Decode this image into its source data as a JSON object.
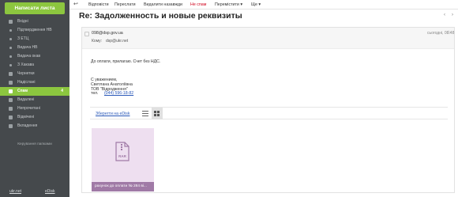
{
  "sidebar": {
    "compose_label": "Написати листа",
    "folders": [
      {
        "label": "Вхідні",
        "icon": "inbox-icon"
      },
      {
        "label": "Підтвердження НВ",
        "icon": "subfolder-dot-icon"
      },
      {
        "label": "З ЕТЦ",
        "icon": "subfolder-dot-icon"
      },
      {
        "label": "Видача НВ",
        "icon": "subfolder-dot-icon"
      },
      {
        "label": "Видача окав",
        "icon": "subfolder-dot-icon"
      },
      {
        "label": "З Хакава",
        "icon": "subfolder-dot-icon"
      },
      {
        "label": "Чернетки",
        "icon": "drafts-icon"
      },
      {
        "label": "Надіслані",
        "icon": "sent-icon"
      },
      {
        "label": "Спам",
        "icon": "spam-icon",
        "count": "4"
      },
      {
        "label": "Видалені",
        "icon": "trash-icon"
      },
      {
        "label": "Непрочитані",
        "icon": "unread-icon"
      },
      {
        "label": "Відмічені",
        "icon": "flagged-icon"
      },
      {
        "label": "Вкладення",
        "icon": "attachments-icon"
      }
    ],
    "manage_label": "Керування папками",
    "footer": {
      "left": "ukr.net",
      "right": "eDisk"
    }
  },
  "toolbar": {
    "back_icon": "back-arrow-icon",
    "reply": "Відповісти",
    "forward": "Переслати",
    "delete": "Видалити назавжди",
    "not_spam": "Не спам",
    "move": "Перемістити ▾",
    "more": "Ще ▾"
  },
  "message": {
    "subject": "Re: Задолженность и новые реквизиты",
    "from": "098@dsp.gov.ua",
    "to_label": "Кому:",
    "to": "dsp@ukr.net",
    "date": "сьогодні, 08:48",
    "body": "До оплати, прилагаю. Счет без НДС.",
    "signature": {
      "line1": "С уважением,",
      "line2": "Светлана Анатоліївна",
      "line3": "ТОВ \"Відродження\"",
      "phone_label": "тел.",
      "phone": "(044) 596-18-82"
    },
    "attachments": {
      "save_label": "Зберегти на eDisk",
      "file_name": "рахунок до оплати № 284 ві...",
      "file_type": "RAR"
    }
  },
  "colors": {
    "sidebar_bg": "#45494c",
    "accent_green": "#8cc63f",
    "spam_red": "#d0021b",
    "link_blue": "#2a58b8",
    "attachment_bg": "#eedff0",
    "attachment_label_bg": "#a07aa6"
  }
}
